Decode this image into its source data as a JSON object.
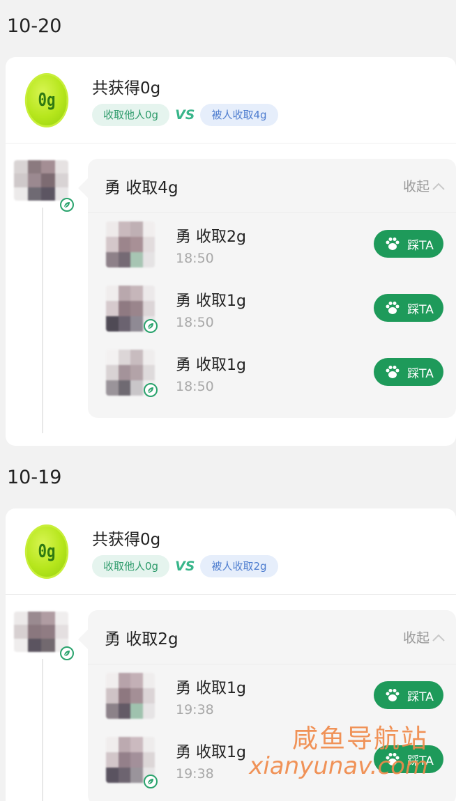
{
  "days": [
    {
      "date": "10-20",
      "summary": {
        "badge": "0g",
        "title": "共获得0g",
        "collected_from_others": "收取他人0g",
        "vs": "VS",
        "collected_by_others": "被人收取4g"
      },
      "group": {
        "title": "勇 收取4g",
        "collapse_label": "收起",
        "items": [
          {
            "name": "勇 收取2g",
            "time": "18:50",
            "action": "踩TA"
          },
          {
            "name": "勇 收取1g",
            "time": "18:50",
            "action": "踩TA"
          },
          {
            "name": "勇 收取1g",
            "time": "18:50",
            "action": "踩TA"
          }
        ]
      }
    },
    {
      "date": "10-19",
      "summary": {
        "badge": "0g",
        "title": "共获得0g",
        "collected_from_others": "收取他人0g",
        "vs": "VS",
        "collected_by_others": "被人收取2g"
      },
      "group": {
        "title": "勇 收取2g",
        "collapse_label": "收起",
        "items": [
          {
            "name": "勇 收取1g",
            "time": "19:38",
            "action": "踩TA"
          },
          {
            "name": "勇 收取1g",
            "time": "19:38",
            "action": "踩TA"
          }
        ]
      }
    }
  ],
  "watermark": {
    "line1": "咸鱼导航站",
    "line2": "xianyunav.com"
  },
  "colors": {
    "accent_green": "#1e9a5a",
    "badge_green": "#b6e61c",
    "take_pill": "#e5f4ee",
    "taken_pill": "#e6eefb",
    "watermark": "#f08a4a"
  },
  "icons": {
    "badge": "energy-ball-icon",
    "collapse": "chevron-up-icon",
    "leaf": "leaf-icon",
    "paw": "paw-icon"
  }
}
